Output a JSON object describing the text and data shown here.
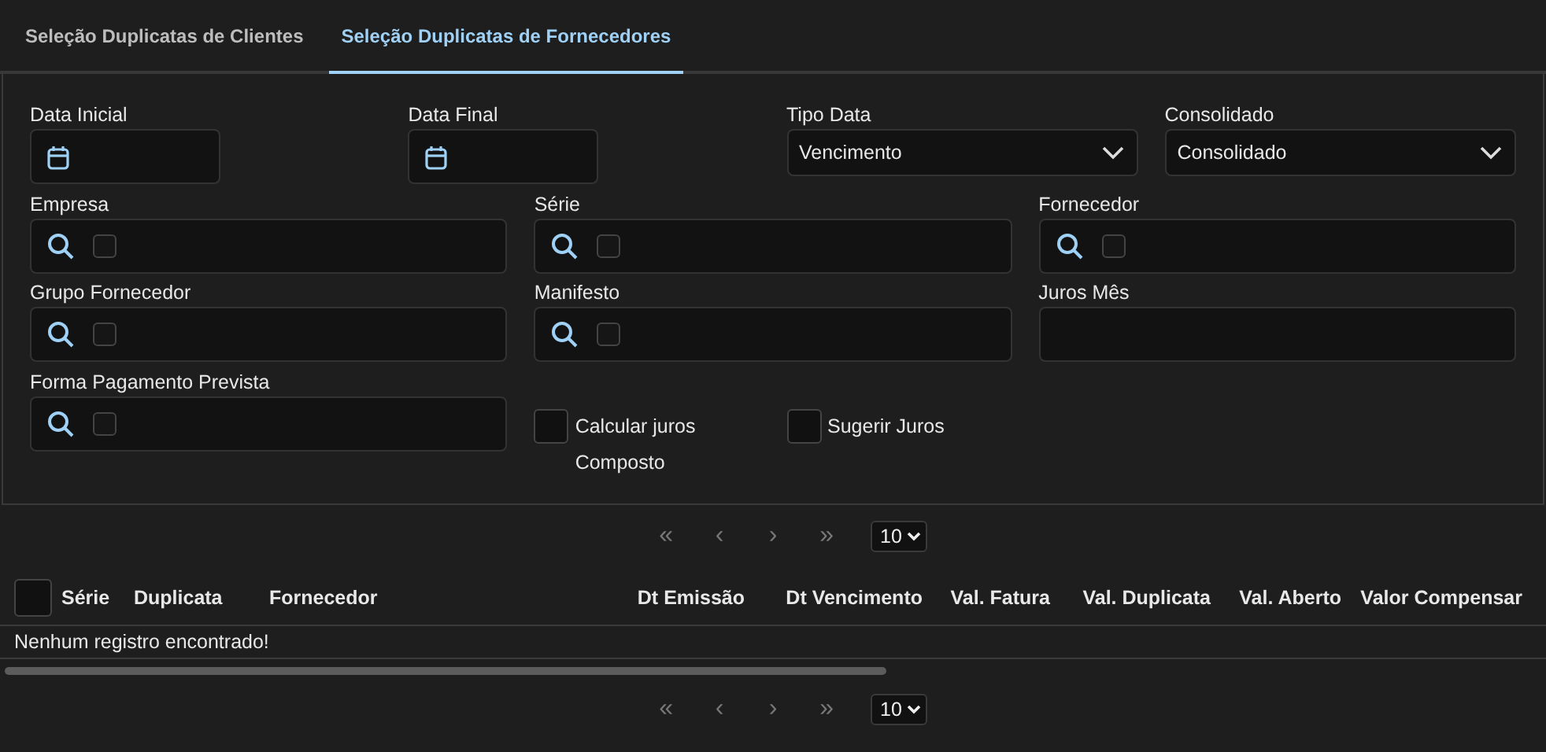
{
  "tabs": [
    {
      "label": "Seleção Duplicatas de Clientes",
      "selected": false
    },
    {
      "label": "Seleção Duplicatas de Fornecedores",
      "selected": true
    }
  ],
  "filters": [
    {
      "kind": "date",
      "label": "Data Inicial"
    },
    {
      "kind": "date",
      "label": "Data Final"
    },
    {
      "kind": "select",
      "label": "Tipo Data",
      "value": "Vencimento"
    },
    {
      "kind": "select",
      "label": "Consolidado",
      "value": "Consolidado"
    },
    {
      "kind": "lookup",
      "label": "Empresa",
      "checked": false
    },
    {
      "kind": "lookup",
      "label": "Série",
      "checked": false
    },
    {
      "kind": "lookup",
      "label": "Fornecedor",
      "checked": false
    },
    {
      "kind": "lookup",
      "label": "Grupo Fornecedor",
      "checked": false
    },
    {
      "kind": "lookup",
      "label": "Manifesto",
      "checked": false
    },
    {
      "kind": "text",
      "label": "Juros Mês"
    },
    {
      "kind": "lookup",
      "label": "Forma Pagamento Prevista",
      "checked": false
    },
    {
      "kind": "checkbox",
      "label": "Calcular juros Composto",
      "checked": false
    },
    {
      "kind": "checkbox",
      "label": "Sugerir Juros",
      "checked": false
    }
  ],
  "paginator_top": {
    "buttons": [
      {
        "label": "«",
        "disabled": true
      },
      {
        "label": "‹",
        "disabled": true
      },
      {
        "label": "›",
        "disabled": true
      },
      {
        "label": "»",
        "disabled": true
      }
    ],
    "page_size": "10"
  },
  "table": {
    "select_all": {
      "checked": false
    },
    "columns": [
      "Série",
      "Duplicata",
      "Fornecedor",
      "Dt Emissão",
      "Dt Vencimento",
      "Val. Fatura",
      "Val. Duplicata",
      "Val. Aberto",
      "Valor Compensar"
    ],
    "empty_message": "Nenhum registro encontrado!"
  },
  "paginator_bottom": {
    "buttons": [
      {
        "label": "«",
        "disabled": true
      },
      {
        "label": "‹",
        "disabled": true
      },
      {
        "label": "›",
        "disabled": true
      },
      {
        "label": "»",
        "disabled": true
      }
    ],
    "page_size": "10"
  }
}
